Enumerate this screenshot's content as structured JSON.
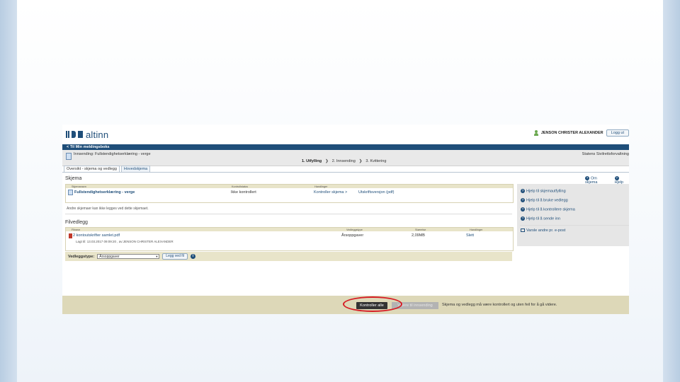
{
  "header": {
    "logo_text": "altinn",
    "user_name": "JENSON CHRISTER ALEXANDER",
    "logout_label": "Logg ut"
  },
  "nav": {
    "back_label": "< Til Min meldingsboks"
  },
  "subheader": {
    "title": "Innsending: Fullstendighetserklæring - verge",
    "agency": "Statens Sivilrettsforvaltning"
  },
  "steps": [
    {
      "label": "1. Utfylling"
    },
    {
      "label": "2. Innsending"
    },
    {
      "label": "3. Kvittering"
    }
  ],
  "tabs": [
    {
      "label": "Oversikt - skjema og vedlegg"
    },
    {
      "label": "Hovedskjema"
    }
  ],
  "skjema": {
    "title": "Skjema",
    "columns": [
      "Skjemanavn",
      "Kontrollstatus",
      "Handlinger"
    ],
    "row": {
      "name": "Fullstendighetserklæring - verge",
      "status": "Ikke kontrollert",
      "action1": "Kontroller skjema >",
      "action2": "Utskriftsversjon (pdf)"
    },
    "note": "Andre skjemaer kan ikke legges ved dette skjemaet."
  },
  "filvedlegg": {
    "title": "Filvedlegg",
    "columns": [
      "Filnavn",
      "Vedleggstype",
      "Størrelse",
      "Handlinger"
    ],
    "row": {
      "filename": "2 kontoutskrifter samlet.pdf",
      "meta": "Lagt til: 13.03.2017 09:09:20 , av:JENSON CHRISTER ALEXANDER",
      "type": "Årsoppgaver",
      "size": "2,09MB",
      "action": "Slett"
    },
    "add_label": "Vedleggstype:",
    "select_value": "Årsoppgaver",
    "add_button": "Legg ved fil"
  },
  "sidebar": {
    "top_links": [
      "Om skjema",
      "Hjelp"
    ],
    "help_items": [
      "Hjelp til skjemautfylling",
      "Hjelp til å bruke vedlegg",
      "Hjelp til å kontrollere skjema",
      "Hjelp til å sende inn"
    ],
    "notify": "Varsle andre pr. e-post"
  },
  "footer": {
    "primary_button": "Kontroller alle",
    "disabled_button": "Videre til innsending",
    "message": "Skjema og vedlegg må være kontrollert og uten feil for å gå videre."
  },
  "colors": {
    "brand": "#1f4e79",
    "highlight": "#d61c24",
    "panel": "#e8e4c9",
    "footer": "#ddd8b8"
  }
}
